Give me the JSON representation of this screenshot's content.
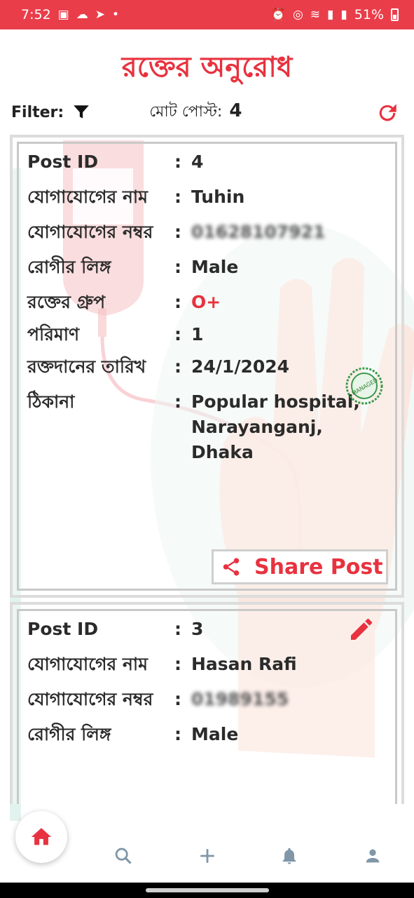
{
  "status_bar": {
    "time": "7:52",
    "battery": "51%",
    "left_icons": [
      "gallery-icon",
      "weather-icon",
      "send-icon",
      "dot-icon"
    ],
    "right_icons": [
      "alarm-icon",
      "hotspot-icon",
      "wifi-icon",
      "signal-icon",
      "signal-icon",
      "battery-icon"
    ]
  },
  "header": {
    "title": "রক্তের অনুরোধ",
    "filter_label": "Filter:",
    "total_label": "মোট পোস্ট:",
    "total_count": "4"
  },
  "posts": [
    {
      "id_label": "Post ID",
      "id": "4",
      "name_label": "যোগাযোগের নাম",
      "name": "Tuhin",
      "phone_label": "যোগাযোগের নম্বর",
      "phone": "01628107921",
      "gender_label": "রোগীর লিঙ্গ",
      "gender": "Male",
      "blood_label": "রক্তের গ্রুপ",
      "blood": "O+",
      "amount_label": "পরিমাণ",
      "amount": "1",
      "date_label": "রক্তদানের তারিখ",
      "date": "24/1/2024",
      "address_label": "ঠিকানা",
      "address": "Popular hospital, Narayanganj, Dhaka",
      "share_label": "Share Post"
    },
    {
      "id_label": "Post ID",
      "id": "3",
      "name_label": "যোগাযোগের নাম",
      "name": "Hasan Rafi",
      "phone_label": "যোগাযোগের নম্বর",
      "phone": "01989155",
      "gender_label": "রোগীর লিঙ্গ",
      "gender": "Male"
    }
  ],
  "colon": ":",
  "stamp_text": "MANAGED",
  "colors": {
    "accent": "#e8323f",
    "statusbar": "#ea3d4a",
    "nav_icon": "#7f97a8"
  },
  "nav": [
    "home-icon",
    "search-icon",
    "plus-icon",
    "bell-icon",
    "person-icon"
  ]
}
